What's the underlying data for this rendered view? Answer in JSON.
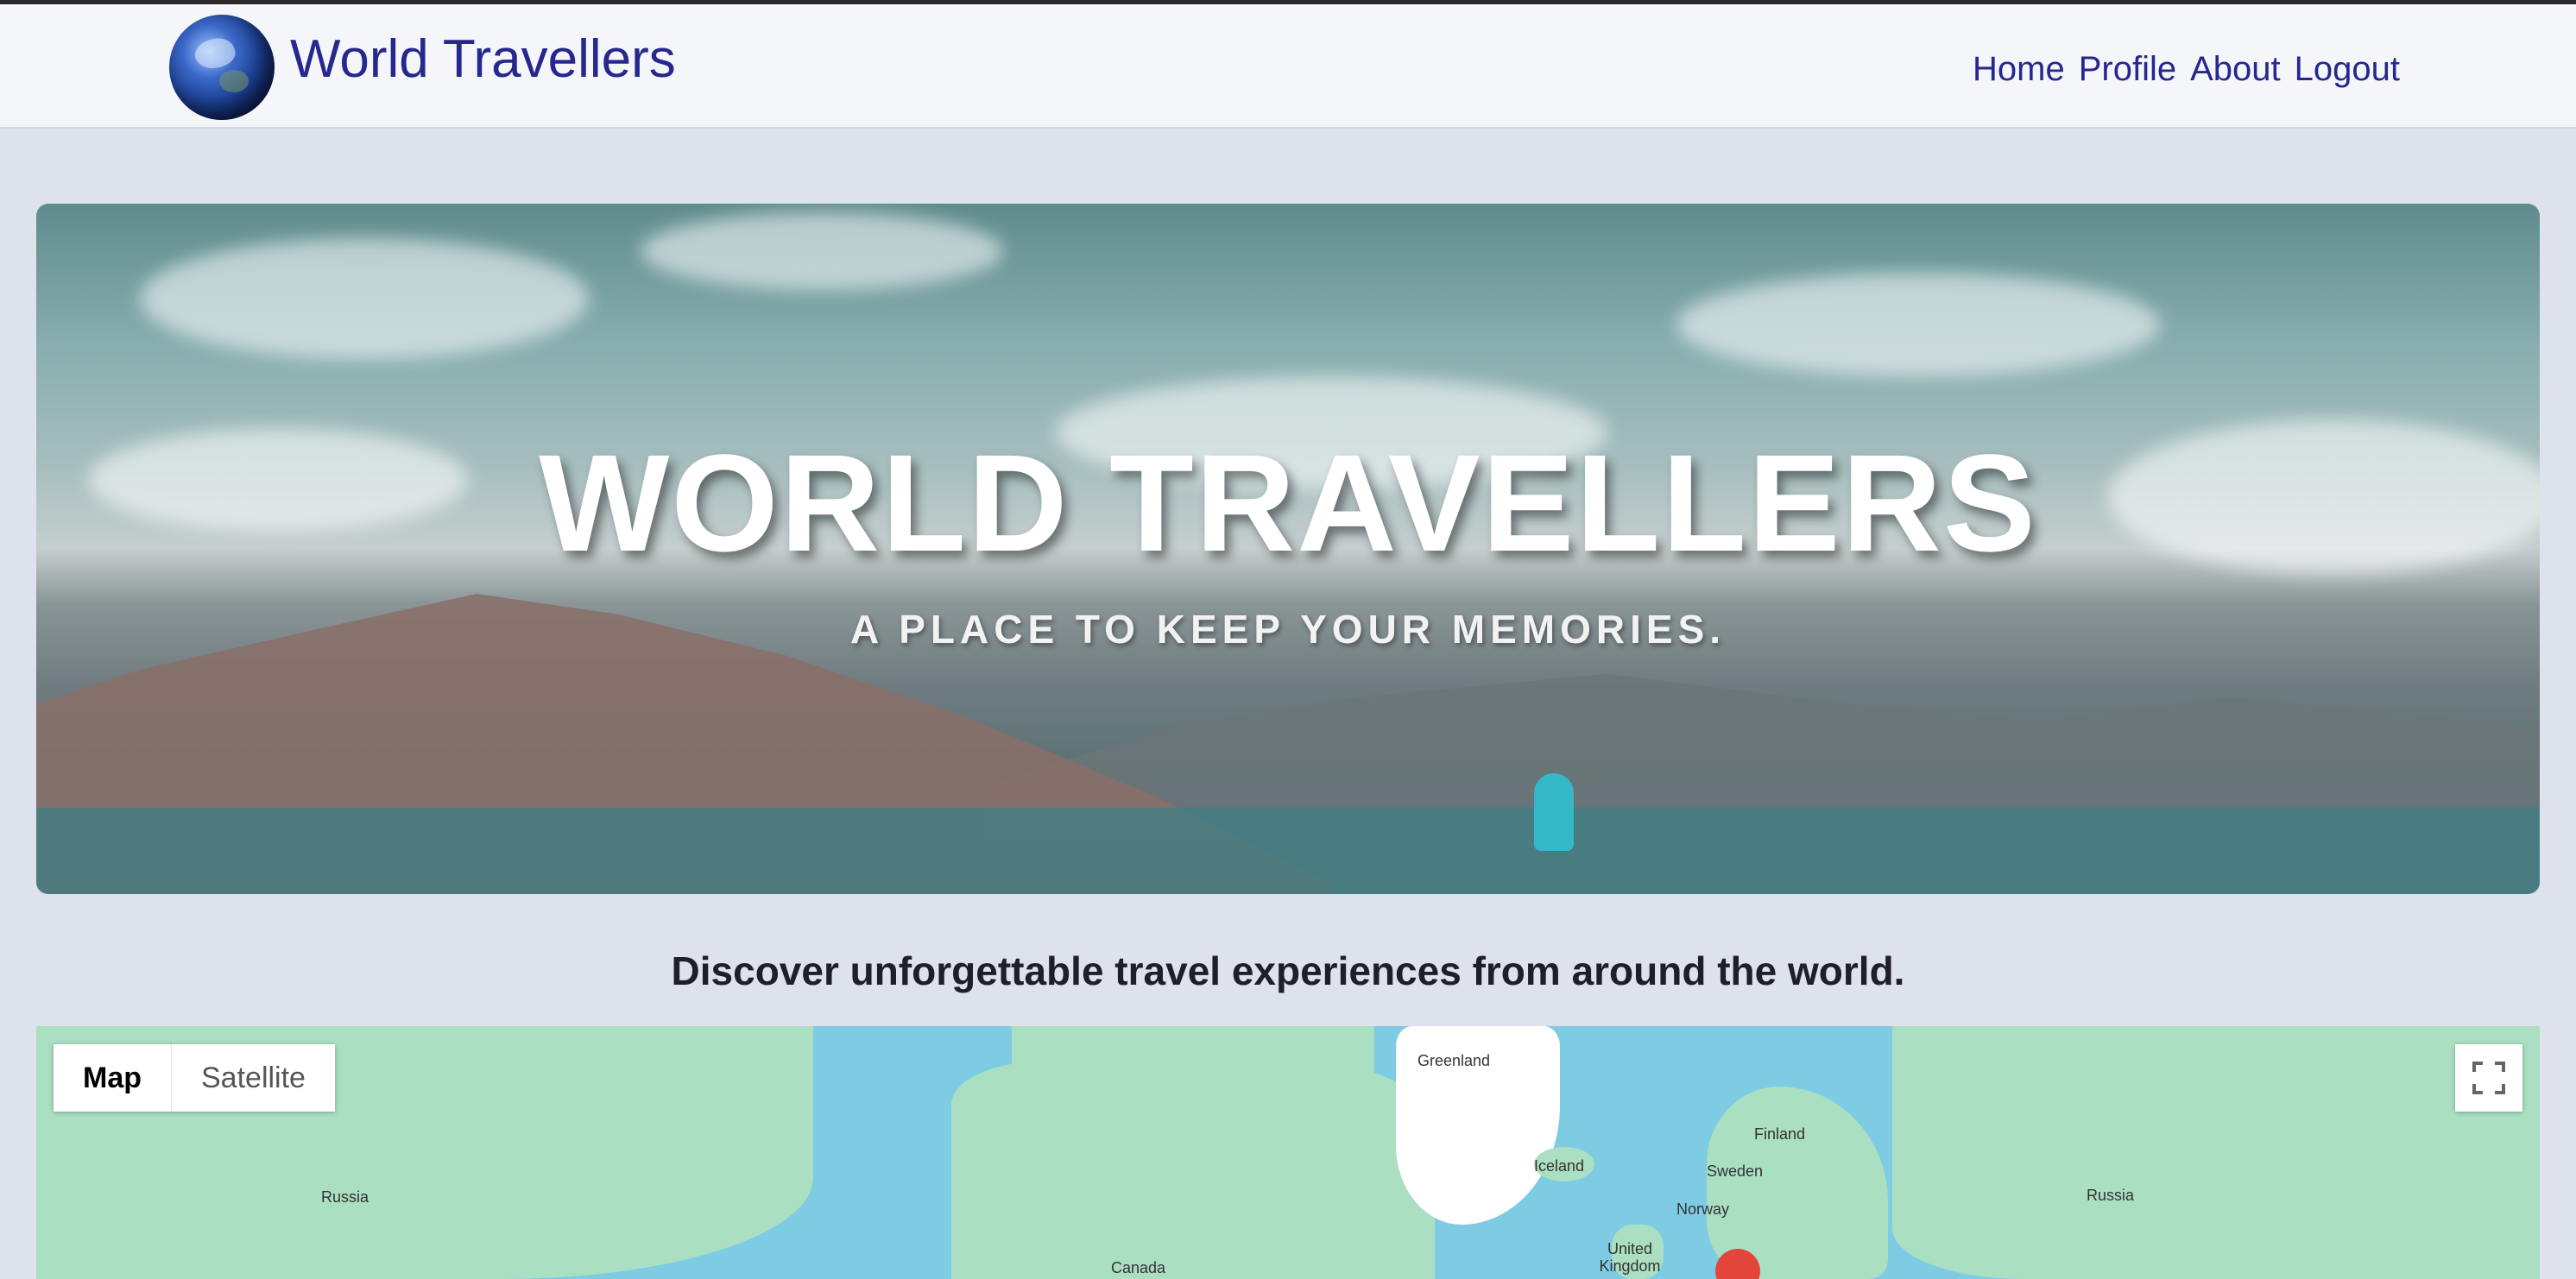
{
  "brand": {
    "title": "World Travellers",
    "logo_icon": "globe-icon"
  },
  "nav": {
    "links": [
      {
        "label": "Home"
      },
      {
        "label": "Profile"
      },
      {
        "label": "About"
      },
      {
        "label": "Logout"
      }
    ]
  },
  "hero": {
    "title": "WORLD TRAVELLERS",
    "subtitle": "A PLACE TO KEEP YOUR MEMORIES."
  },
  "tagline": "Discover unforgettable travel experiences from around the world.",
  "map": {
    "type_buttons": [
      {
        "label": "Map",
        "active": true
      },
      {
        "label": "Satellite",
        "active": false
      }
    ],
    "fullscreen_icon": "fullscreen-icon",
    "marker_icon": "map-pin-icon",
    "labels": {
      "greenland": "Greenland",
      "finland": "Finland",
      "iceland": "Iceland",
      "sweden": "Sweden",
      "russia_left": "Russia",
      "russia_right": "Russia",
      "norway": "Norway",
      "united_kingdom": "United Kingdom",
      "canada": "Canada"
    }
  },
  "colors": {
    "brand": "#26278f",
    "page_bg": "#dee2ec",
    "navbar_bg": "#f5f6f9",
    "water": "#7ecbe4",
    "land": "#aadfc2"
  }
}
